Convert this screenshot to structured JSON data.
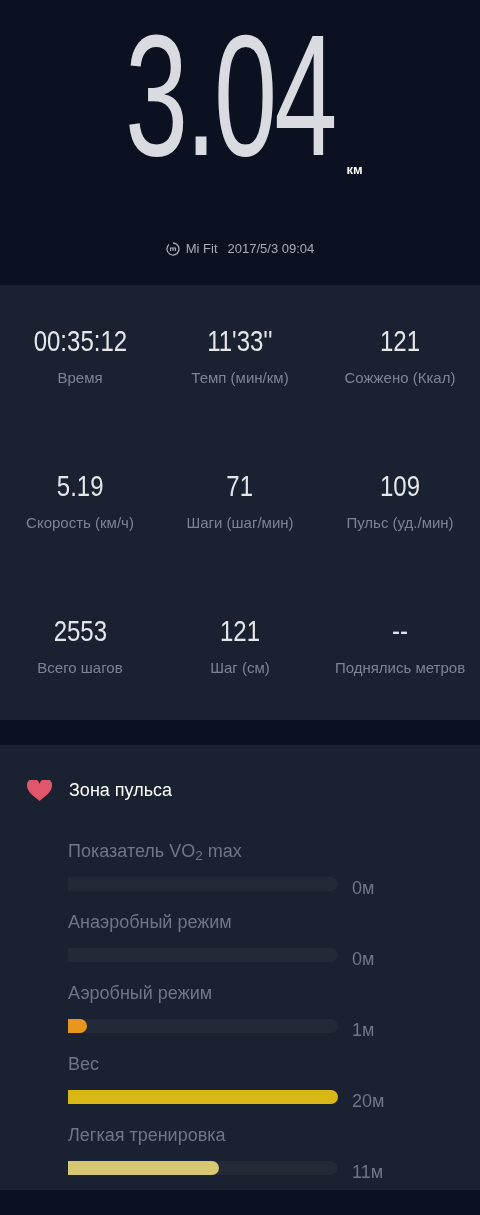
{
  "distance": {
    "value": "3.04",
    "unit": "км"
  },
  "source": {
    "app": "Mi Fit",
    "datetime": "2017/5/3 09:04"
  },
  "stats": [
    {
      "value": "00:35:12",
      "label": "Время"
    },
    {
      "value": "11'33''",
      "label": "Темп (мин/км)"
    },
    {
      "value": "121",
      "label": "Сожжено (Ккал)"
    },
    {
      "value": "5.19",
      "label": "Скорость (км/ч)"
    },
    {
      "value": "71",
      "label": "Шаги (шаг/мин)"
    },
    {
      "value": "109",
      "label": "Пульс (уд./мин)"
    },
    {
      "value": "2553",
      "label": "Всего шагов"
    },
    {
      "value": "121",
      "label": "Шаг (см)"
    },
    {
      "value": "--",
      "label": "Поднялись метров"
    }
  ],
  "heart_zone": {
    "title": "Зона пульса",
    "zones": [
      {
        "label": "Показатель VO$_{2}$ max",
        "reading": "0м"
      },
      {
        "label": "Анаэробный режим",
        "reading": "0м"
      },
      {
        "label": "Аэробный режим",
        "level": 0.07,
        "reading": "1м",
        "color": "#e8961e"
      },
      {
        "label": "Вес",
        "level": 1,
        "reading": "20м",
        "color": "#d9b816"
      },
      {
        "label": "Легкая тренировка",
        "level": 0.56,
        "reading": "11м",
        "color": "#d8c873"
      }
    ]
  }
}
